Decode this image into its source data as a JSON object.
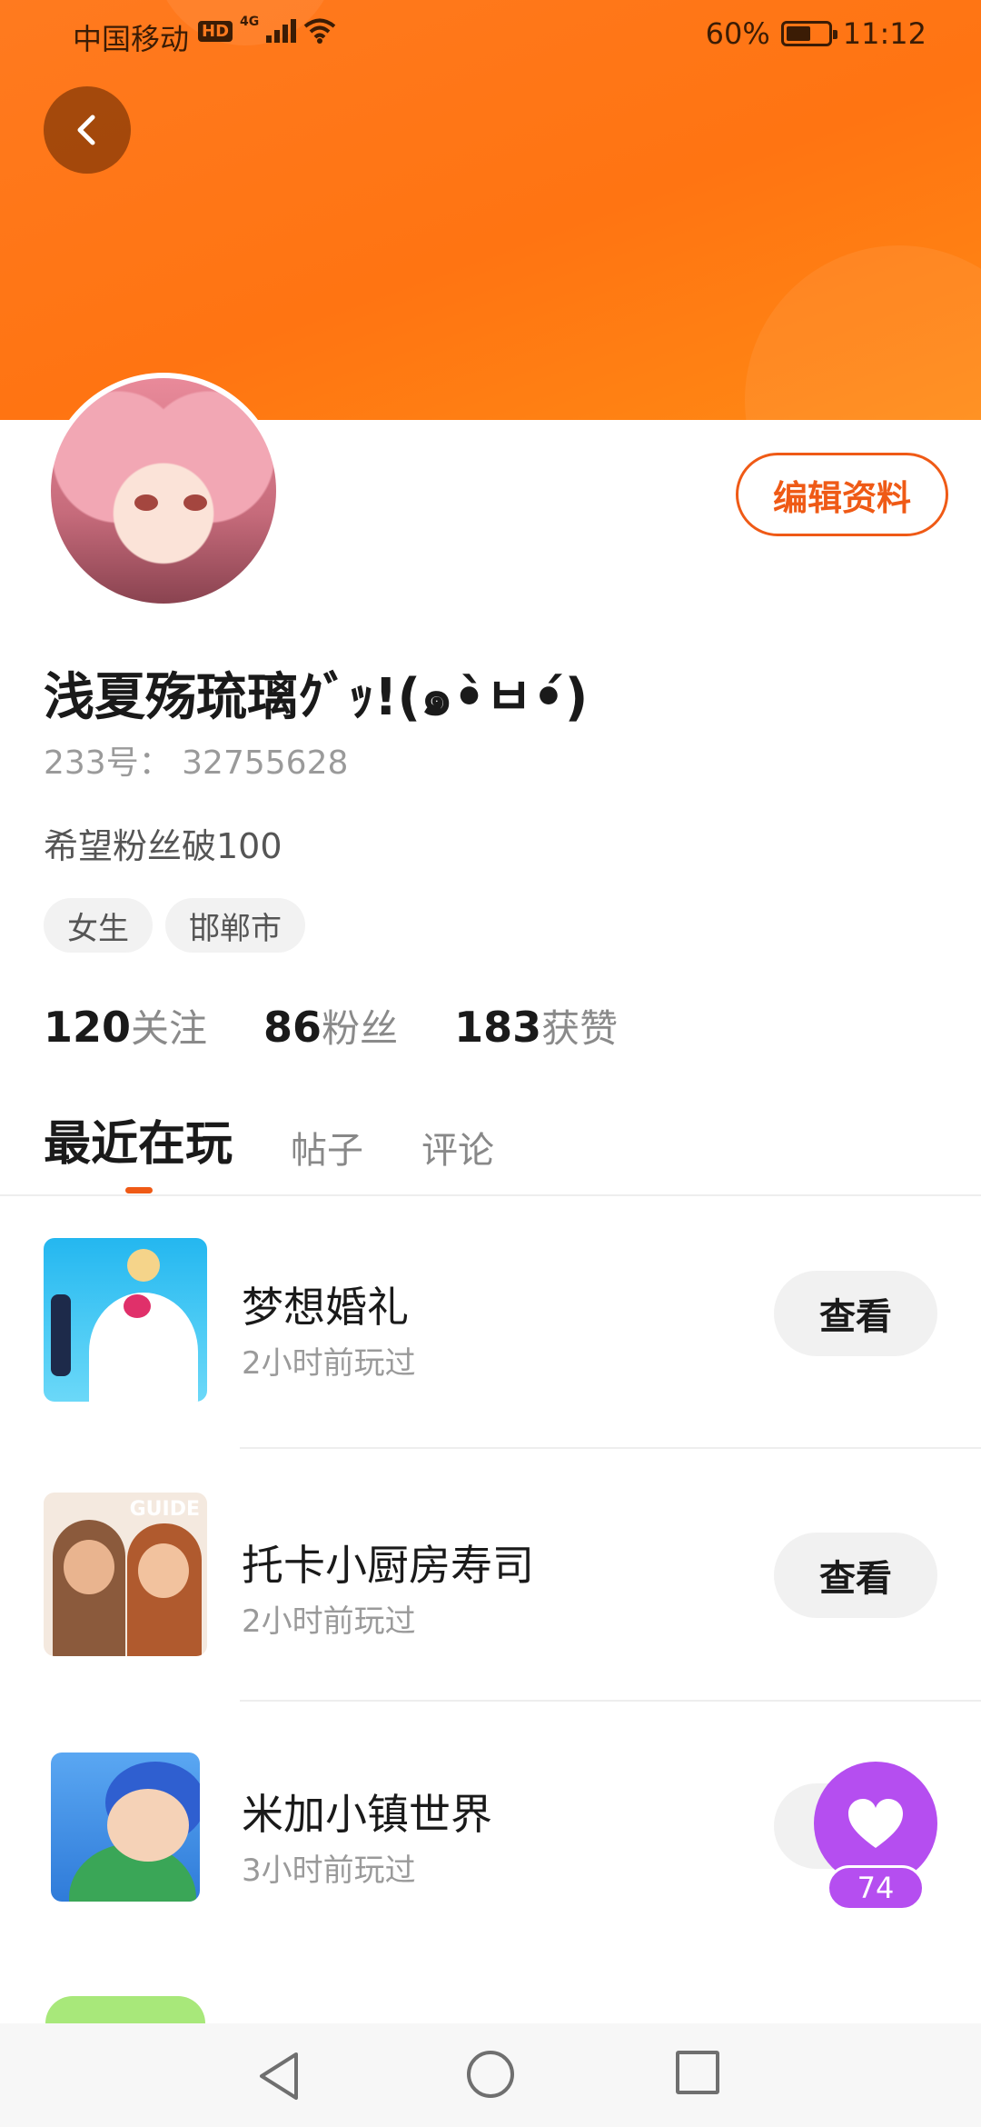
{
  "status_bar": {
    "carrier": "中国移动",
    "hd": "HD",
    "network": "4G",
    "battery_text": "60%",
    "battery_level": 0.6,
    "time": "11:12"
  },
  "profile": {
    "name": "浅夏殇琉璃ｸﾞｯ!(๑•̀ㅂ•́)",
    "uid": "233号：  32755628",
    "bio": "希望粉丝破100",
    "edit_label": "编辑资料",
    "tags": [
      "女生",
      "邯郸市"
    ],
    "stats": [
      {
        "num": "120",
        "label": "关注"
      },
      {
        "num": "86",
        "label": "粉丝"
      },
      {
        "num": "183",
        "label": "获赞"
      }
    ]
  },
  "tabs": [
    {
      "label": "最近在玩",
      "active": true
    },
    {
      "label": "帖子",
      "active": false
    },
    {
      "label": "评论",
      "active": false
    }
  ],
  "games": [
    {
      "title": "梦想婚礼",
      "time": "2小时前玩过",
      "button": "查看",
      "icon": "wedding-game-icon"
    },
    {
      "title": "托卡小厨房寿司",
      "time": "2小时前玩过",
      "button": "查看",
      "icon": "toca-game-icon"
    },
    {
      "title": "米加小镇世界",
      "time": "3小时前玩过",
      "button": "",
      "icon": "miga-game-icon"
    }
  ],
  "toca_icon_text": "GUIDE",
  "fab": {
    "count": "74"
  },
  "colors": {
    "accent": "#ef5a16",
    "banner": "#ff7a1f",
    "fab": "#b54ef0"
  }
}
